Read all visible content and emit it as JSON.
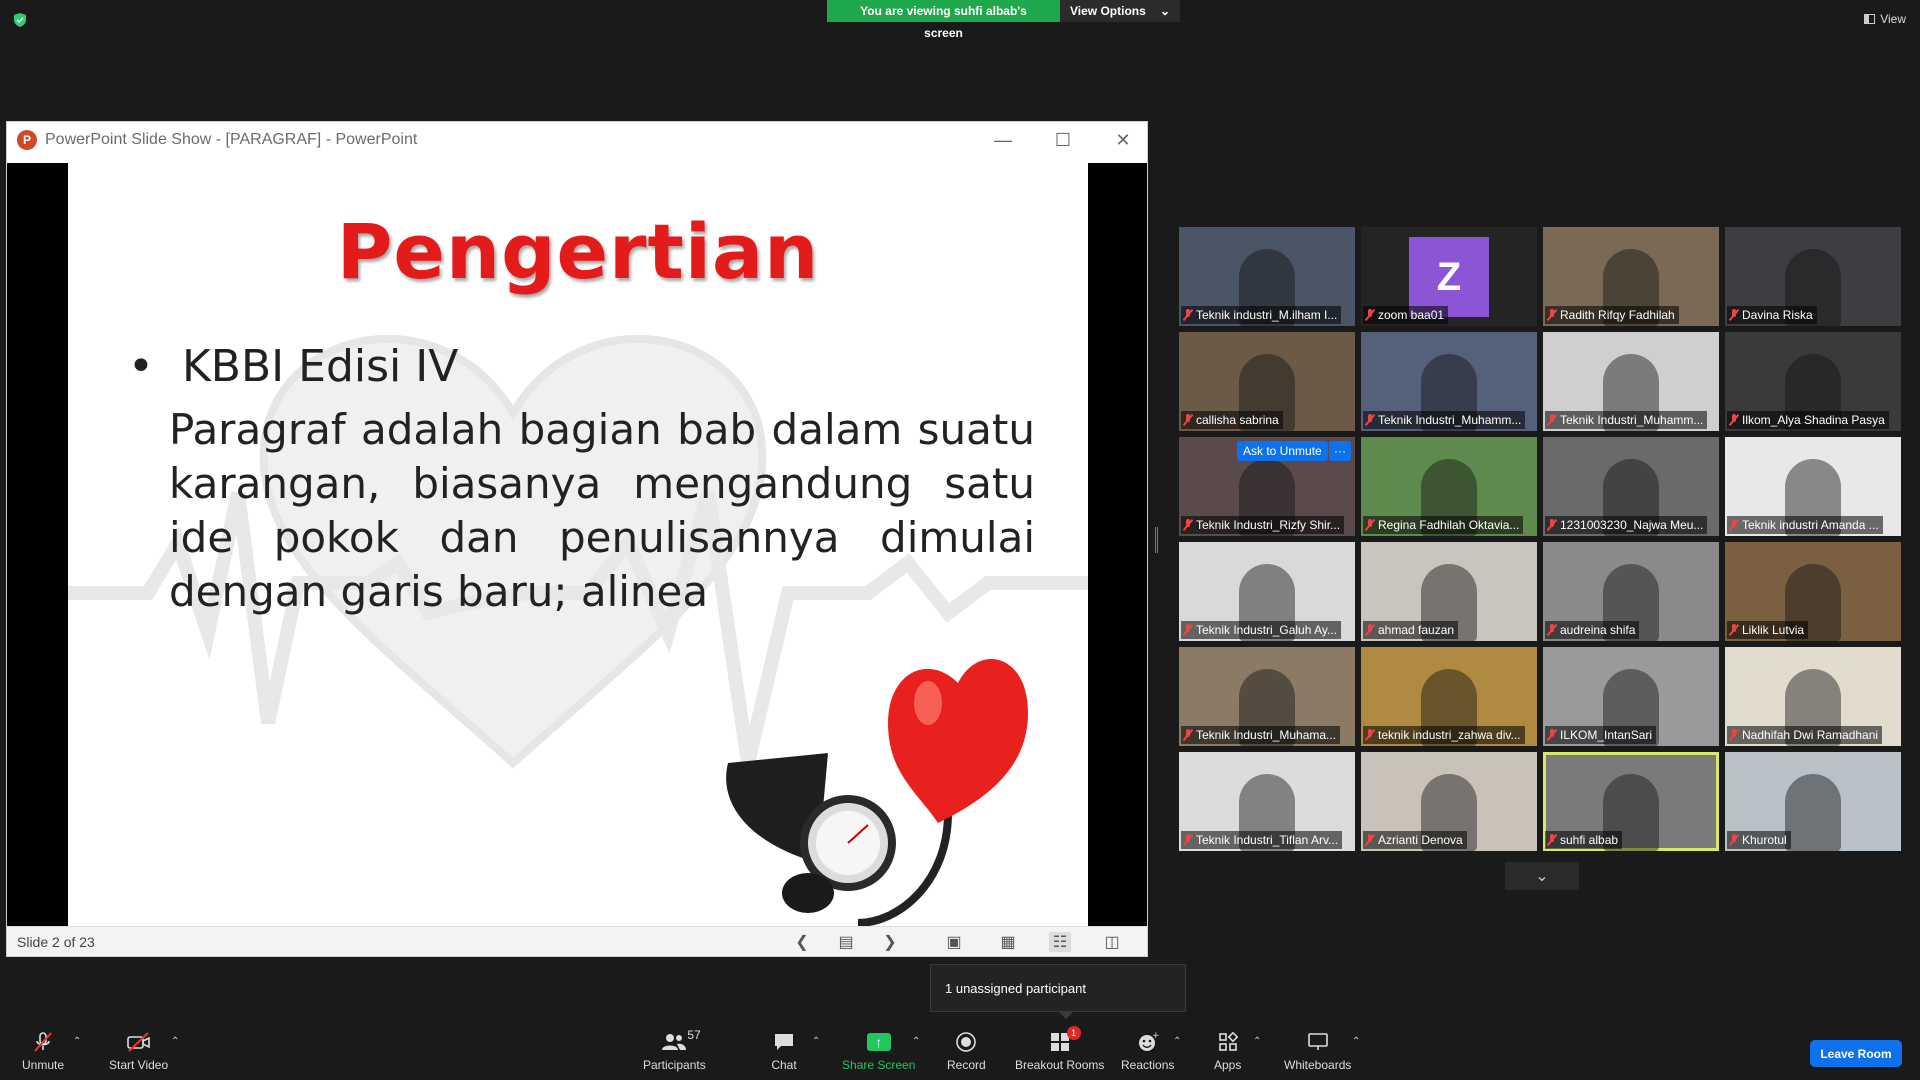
{
  "banner": {
    "viewing_text": "You are viewing suhfi albab's screen",
    "options_label": "View Options"
  },
  "view_label": "View",
  "ppt": {
    "window_title": "PowerPoint Slide Show - [PARAGRAF] - PowerPoint",
    "slide_title": "Pengertian",
    "bullet": "KBBI Edisi IV",
    "paragraph": "Paragraf adalah bagian bab dalam suatu karangan, biasanya mengandung satu ide pokok dan penulisannya dimulai dengan garis baru; alinea",
    "status": "Slide 2 of 23"
  },
  "gallery": {
    "participants": [
      {
        "name": "Teknik industri_M.ilham I...",
        "bg": "#4a5566"
      },
      {
        "name": "zoom baa01",
        "bg": "#242424",
        "avatar": "Z"
      },
      {
        "name": "Radith Rifqy Fadhilah",
        "bg": "#7a6a55"
      },
      {
        "name": "Davina Riska",
        "bg": "#3d3d42"
      },
      {
        "name": "callisha sabrina",
        "bg": "#6b5a48"
      },
      {
        "name": "Teknik Industri_Muhamm...",
        "bg": "#55607a"
      },
      {
        "name": "Teknik Industri_Muhamm...",
        "bg": "#cfcfcf"
      },
      {
        "name": "Ilkom_Alya Shadina Pasya",
        "bg": "#3a3a3a"
      },
      {
        "name": "Teknik Industri_Rizfy Shir...",
        "bg": "#5a4a4c",
        "ask_unmute": "Ask to Unmute",
        "more": "···"
      },
      {
        "name": "Regina Fadhilah Oktavia...",
        "bg": "#5f8a4e"
      },
      {
        "name": "1231003230_Najwa Meu...",
        "bg": "#6a6a6a"
      },
      {
        "name": "Teknik industri Amanda ...",
        "bg": "#e8e8e8"
      },
      {
        "name": "Teknik Industri_Galuh Ay...",
        "bg": "#d9d9d9"
      },
      {
        "name": "ahmad fauzan",
        "bg": "#c9c4bc"
      },
      {
        "name": "audreina shifa",
        "bg": "#8a8a8a"
      },
      {
        "name": "Liklik Lutvia",
        "bg": "#7a6040"
      },
      {
        "name": "Teknik Industri_Muhama...",
        "bg": "#8a7a66"
      },
      {
        "name": "teknik industri_zahwa div...",
        "bg": "#b08a40"
      },
      {
        "name": "ILKOM_IntanSari",
        "bg": "#9a9a9a"
      },
      {
        "name": "Nadhifah Dwi Ramadhani",
        "bg": "#e2dccf"
      },
      {
        "name": "Teknik Industri_Tiflan Arv...",
        "bg": "#dcdcdc"
      },
      {
        "name": "Azrianti Denova",
        "bg": "#c8c2b8"
      },
      {
        "name": "suhfi albab",
        "bg": "#7a7a7a",
        "active": true
      },
      {
        "name": "Khurotul",
        "bg": "#b8c2c8"
      }
    ]
  },
  "tooltip": "1 unassigned participant",
  "toolbar": {
    "unmute": "Unmute",
    "start_video": "Start Video",
    "participants": "Participants",
    "participants_count": "57",
    "chat": "Chat",
    "share_screen": "Share Screen",
    "record": "Record",
    "breakout_rooms": "Breakout Rooms",
    "breakout_badge": "1",
    "reactions": "Reactions",
    "apps": "Apps",
    "whiteboards": "Whiteboards",
    "leave": "Leave Room"
  }
}
